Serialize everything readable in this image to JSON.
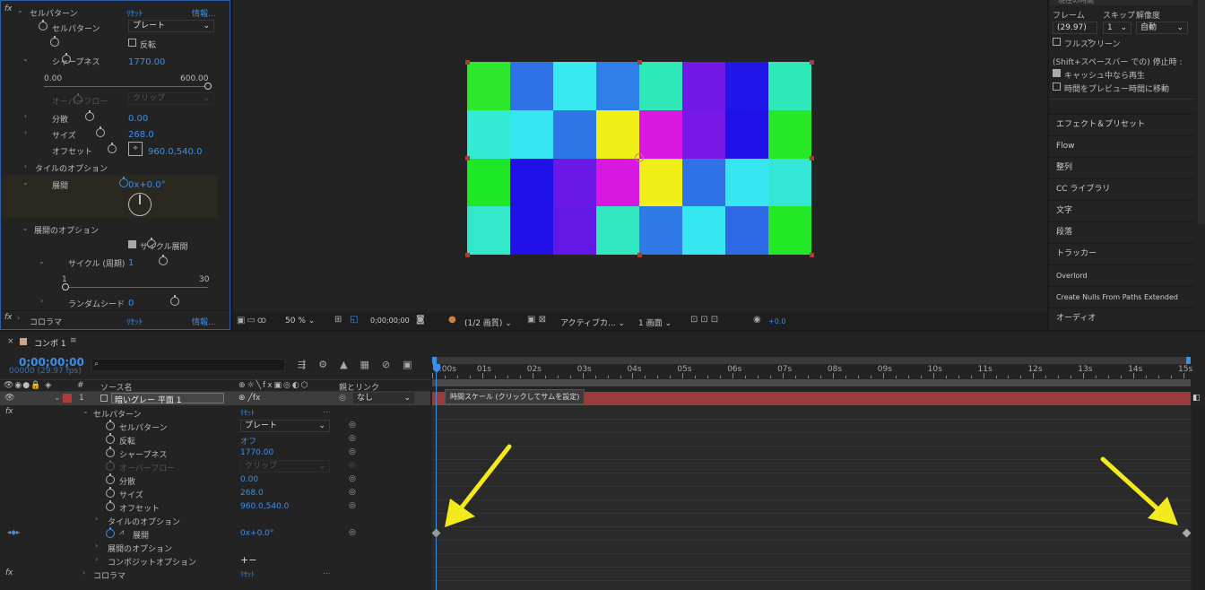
{
  "effect_controls": {
    "fx_label": "fx",
    "effect1": {
      "name": "セルパターン",
      "reset": "ﾘｾｯﾄ",
      "info": "情報..."
    },
    "cell_pattern": {
      "label": "セルパターン",
      "value": "プレート"
    },
    "invert": {
      "label": "反転"
    },
    "sharpness": {
      "label": "シャープネス",
      "value": "1770.00",
      "min": "0.00",
      "max": "600.00",
      "level": 1.0
    },
    "overflow": {
      "label": "オーバーフロー",
      "value": "クリップ"
    },
    "dispersion": {
      "label": "分散",
      "value": "0.00"
    },
    "size": {
      "label": "サイズ",
      "value": "268.0"
    },
    "offset": {
      "label": "オフセット",
      "value": "960.0,540.0"
    },
    "tiling": {
      "label": "タイルのオプション"
    },
    "evolution": {
      "label": "展開",
      "value": "0x+0.0°"
    },
    "evo_options": {
      "label": "展開のオプション"
    },
    "cycle_evo": {
      "label": "サイクル展開"
    },
    "cycle": {
      "label": "サイクル (周期)",
      "value": "1",
      "min": "1",
      "max": "30",
      "level": 0.0
    },
    "random_seed": {
      "label": "ランダムシード",
      "value": "0"
    },
    "effect2": {
      "name": "コロラマ",
      "reset": "ﾘｾｯﾄ",
      "info": "情報..."
    }
  },
  "viewer": {
    "grid_colors": [
      [
        "#2ee82e",
        "#2f72e6",
        "#36eaf0",
        "#2f7de6",
        "#2ee8b8",
        "#7218e6",
        "#2016e8",
        "#2ee8b8"
      ],
      [
        "#33ead2",
        "#36e6f0",
        "#2f77e6",
        "#f0f018",
        "#d818e0",
        "#7818e6",
        "#2010e8",
        "#26e826"
      ],
      [
        "#1ee826",
        "#2010e8",
        "#6a18e6",
        "#d818e0",
        "#f0f018",
        "#2f72e6",
        "#36e6f0",
        "#33e6d6"
      ],
      [
        "#33e8c8",
        "#2210e8",
        "#6418e6",
        "#33e8c0",
        "#2f7ae6",
        "#36e6f0",
        "#2f6ae6",
        "#22e828"
      ]
    ]
  },
  "viewer_toolbar": {
    "zoom": "50 %",
    "timecode": "0;00;00;00",
    "resolution": "(1/2 画質)",
    "camera": "アクティブカ...",
    "views": "1 画面",
    "exposure": "+0.0"
  },
  "preview_panel": {
    "header": "現在の時間",
    "frame_label": "フレーム",
    "skip_label": "スキップ",
    "res_label": "解像度",
    "frame_value": "(29.97)",
    "skip_value": "1",
    "res_value": "自動",
    "fullscreen": "フルスクリーン",
    "stop_label": "(Shift+スペースバー での) 停止時 :",
    "cache_play": "キャッシュ中なら再生",
    "move_time": "時間をプレビュー時間に移動",
    "items": [
      "エフェクト＆プリセット",
      "Flow",
      "整列",
      "CC ライブラリ",
      "文字",
      "段落",
      "トラッカー",
      "Overlord",
      "Create Nulls From Paths Extended",
      "オーディオ"
    ]
  },
  "timeline": {
    "tab": "コンポ 1",
    "timecode": "0;00;00;00",
    "fps": "00000 (29.97 fps)",
    "search_placeholder": "",
    "col_num": "#",
    "col_source": "ソース名",
    "col_parent": "親とリンク",
    "layer": {
      "num": "1",
      "name": "暗いグレー 平面 1",
      "parent": "なし"
    },
    "time_scale_tooltip": "時間スケール (クリックしてサムを設定)",
    "ruler": [
      "0:00s",
      "01s",
      "02s",
      "03s",
      "04s",
      "05s",
      "06s",
      "07s",
      "08s",
      "09s",
      "10s",
      "11s",
      "12s",
      "13s",
      "14s",
      "15s"
    ],
    "rows": {
      "fx": "fx",
      "cellpattern": {
        "label": "セルパターン",
        "value": "ﾘｾｯﾄ",
        "dots": "..."
      },
      "cell": {
        "label": "セルパターン",
        "value": "プレート"
      },
      "invert": {
        "label": "反転",
        "value": "オフ"
      },
      "sharp": {
        "label": "シャープネス",
        "value": "1770.00"
      },
      "overflow": {
        "label": "オーバーフロー",
        "value": "クリップ"
      },
      "disp": {
        "label": "分散",
        "value": "0.00"
      },
      "size": {
        "label": "サイズ",
        "value": "268.0"
      },
      "offset": {
        "label": "オフセット",
        "value": "960.0,540.0"
      },
      "tiling": {
        "label": "タイルのオプション"
      },
      "evo": {
        "label": "展開",
        "value": "0x+0.0°"
      },
      "evoopt": {
        "label": "展開のオプション"
      },
      "compopt": {
        "label": "コンポジットオプション",
        "value": "+−"
      },
      "colorama": {
        "label": "コロラマ",
        "value": "ﾘｾｯﾄ",
        "dots": "..."
      }
    }
  }
}
